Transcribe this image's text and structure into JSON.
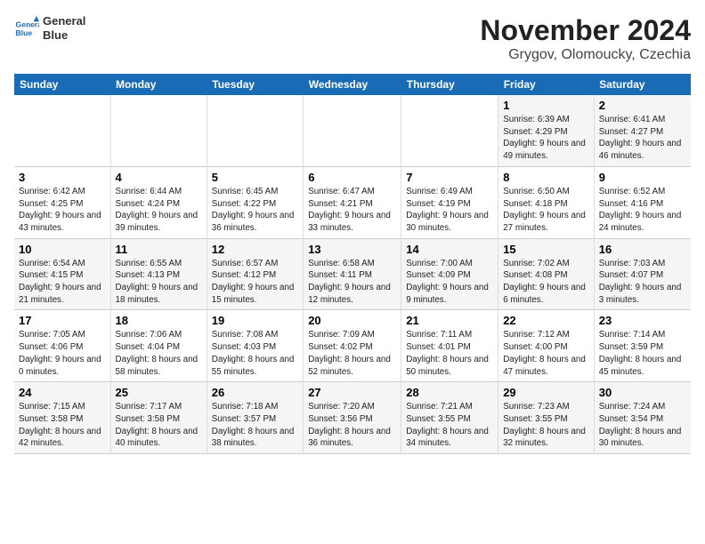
{
  "logo": {
    "line1": "General",
    "line2": "Blue"
  },
  "title": "November 2024",
  "subtitle": "Grygov, Olomoucky, Czechia",
  "days_header": [
    "Sunday",
    "Monday",
    "Tuesday",
    "Wednesday",
    "Thursday",
    "Friday",
    "Saturday"
  ],
  "weeks": [
    [
      {
        "day": "",
        "info": ""
      },
      {
        "day": "",
        "info": ""
      },
      {
        "day": "",
        "info": ""
      },
      {
        "day": "",
        "info": ""
      },
      {
        "day": "",
        "info": ""
      },
      {
        "day": "1",
        "info": "Sunrise: 6:39 AM\nSunset: 4:29 PM\nDaylight: 9 hours and 49 minutes."
      },
      {
        "day": "2",
        "info": "Sunrise: 6:41 AM\nSunset: 4:27 PM\nDaylight: 9 hours and 46 minutes."
      }
    ],
    [
      {
        "day": "3",
        "info": "Sunrise: 6:42 AM\nSunset: 4:25 PM\nDaylight: 9 hours and 43 minutes."
      },
      {
        "day": "4",
        "info": "Sunrise: 6:44 AM\nSunset: 4:24 PM\nDaylight: 9 hours and 39 minutes."
      },
      {
        "day": "5",
        "info": "Sunrise: 6:45 AM\nSunset: 4:22 PM\nDaylight: 9 hours and 36 minutes."
      },
      {
        "day": "6",
        "info": "Sunrise: 6:47 AM\nSunset: 4:21 PM\nDaylight: 9 hours and 33 minutes."
      },
      {
        "day": "7",
        "info": "Sunrise: 6:49 AM\nSunset: 4:19 PM\nDaylight: 9 hours and 30 minutes."
      },
      {
        "day": "8",
        "info": "Sunrise: 6:50 AM\nSunset: 4:18 PM\nDaylight: 9 hours and 27 minutes."
      },
      {
        "day": "9",
        "info": "Sunrise: 6:52 AM\nSunset: 4:16 PM\nDaylight: 9 hours and 24 minutes."
      }
    ],
    [
      {
        "day": "10",
        "info": "Sunrise: 6:54 AM\nSunset: 4:15 PM\nDaylight: 9 hours and 21 minutes."
      },
      {
        "day": "11",
        "info": "Sunrise: 6:55 AM\nSunset: 4:13 PM\nDaylight: 9 hours and 18 minutes."
      },
      {
        "day": "12",
        "info": "Sunrise: 6:57 AM\nSunset: 4:12 PM\nDaylight: 9 hours and 15 minutes."
      },
      {
        "day": "13",
        "info": "Sunrise: 6:58 AM\nSunset: 4:11 PM\nDaylight: 9 hours and 12 minutes."
      },
      {
        "day": "14",
        "info": "Sunrise: 7:00 AM\nSunset: 4:09 PM\nDaylight: 9 hours and 9 minutes."
      },
      {
        "day": "15",
        "info": "Sunrise: 7:02 AM\nSunset: 4:08 PM\nDaylight: 9 hours and 6 minutes."
      },
      {
        "day": "16",
        "info": "Sunrise: 7:03 AM\nSunset: 4:07 PM\nDaylight: 9 hours and 3 minutes."
      }
    ],
    [
      {
        "day": "17",
        "info": "Sunrise: 7:05 AM\nSunset: 4:06 PM\nDaylight: 9 hours and 0 minutes."
      },
      {
        "day": "18",
        "info": "Sunrise: 7:06 AM\nSunset: 4:04 PM\nDaylight: 8 hours and 58 minutes."
      },
      {
        "day": "19",
        "info": "Sunrise: 7:08 AM\nSunset: 4:03 PM\nDaylight: 8 hours and 55 minutes."
      },
      {
        "day": "20",
        "info": "Sunrise: 7:09 AM\nSunset: 4:02 PM\nDaylight: 8 hours and 52 minutes."
      },
      {
        "day": "21",
        "info": "Sunrise: 7:11 AM\nSunset: 4:01 PM\nDaylight: 8 hours and 50 minutes."
      },
      {
        "day": "22",
        "info": "Sunrise: 7:12 AM\nSunset: 4:00 PM\nDaylight: 8 hours and 47 minutes."
      },
      {
        "day": "23",
        "info": "Sunrise: 7:14 AM\nSunset: 3:59 PM\nDaylight: 8 hours and 45 minutes."
      }
    ],
    [
      {
        "day": "24",
        "info": "Sunrise: 7:15 AM\nSunset: 3:58 PM\nDaylight: 8 hours and 42 minutes."
      },
      {
        "day": "25",
        "info": "Sunrise: 7:17 AM\nSunset: 3:58 PM\nDaylight: 8 hours and 40 minutes."
      },
      {
        "day": "26",
        "info": "Sunrise: 7:18 AM\nSunset: 3:57 PM\nDaylight: 8 hours and 38 minutes."
      },
      {
        "day": "27",
        "info": "Sunrise: 7:20 AM\nSunset: 3:56 PM\nDaylight: 8 hours and 36 minutes."
      },
      {
        "day": "28",
        "info": "Sunrise: 7:21 AM\nSunset: 3:55 PM\nDaylight: 8 hours and 34 minutes."
      },
      {
        "day": "29",
        "info": "Sunrise: 7:23 AM\nSunset: 3:55 PM\nDaylight: 8 hours and 32 minutes."
      },
      {
        "day": "30",
        "info": "Sunrise: 7:24 AM\nSunset: 3:54 PM\nDaylight: 8 hours and 30 minutes."
      }
    ]
  ]
}
